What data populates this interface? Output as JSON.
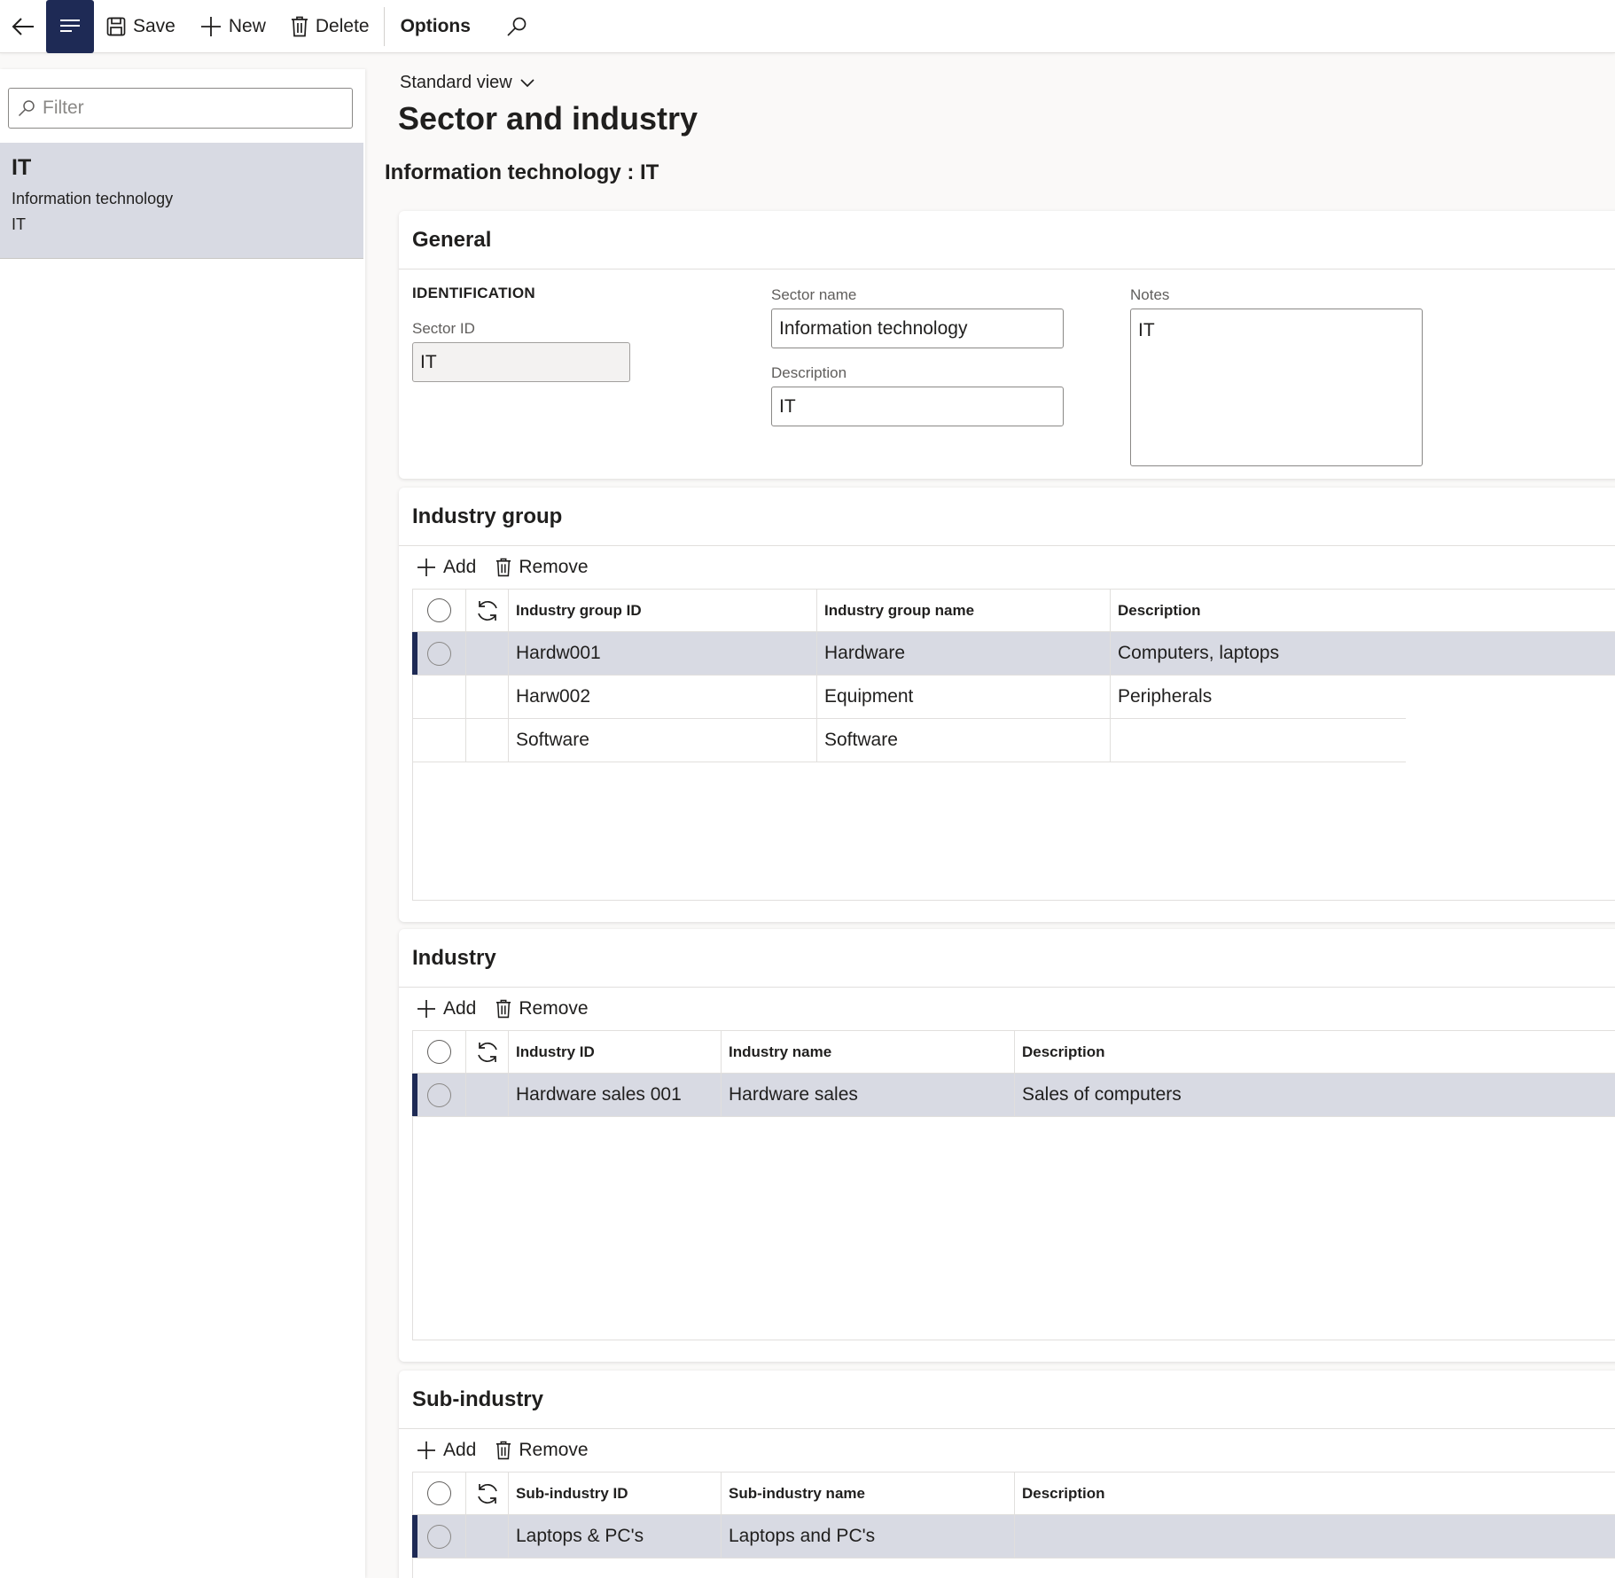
{
  "toolbar": {
    "save": "Save",
    "new": "New",
    "delete": "Delete",
    "options": "Options"
  },
  "list": {
    "filter_placeholder": "Filter",
    "items": [
      {
        "title": "IT",
        "line1": "Information technology",
        "line2": "IT"
      }
    ]
  },
  "header": {
    "view": "Standard view",
    "title": "Sector and industry",
    "record": "Information technology : IT"
  },
  "general": {
    "title": "General",
    "section": "IDENTIFICATION",
    "sector_id_label": "Sector ID",
    "sector_id": "IT",
    "sector_name_label": "Sector name",
    "sector_name": "Information technology",
    "description_label": "Description",
    "description": "IT",
    "notes_label": "Notes",
    "notes": "IT"
  },
  "industry_group": {
    "title": "Industry group",
    "add": "Add",
    "remove": "Remove",
    "columns": [
      "Industry group ID",
      "Industry group name",
      "Description"
    ],
    "rows": [
      [
        "Hardw001",
        "Hardware",
        "Computers, laptops"
      ],
      [
        "Harw002",
        "Equipment",
        "Peripherals"
      ],
      [
        "Software",
        "Software",
        ""
      ]
    ]
  },
  "industry": {
    "title": "Industry",
    "add": "Add",
    "remove": "Remove",
    "columns": [
      "Industry ID",
      "Industry name",
      "Description"
    ],
    "rows": [
      [
        "Hardware sales 001",
        "Hardware sales",
        "Sales of computers"
      ]
    ]
  },
  "sub_industry": {
    "title": "Sub-industry",
    "add": "Add",
    "remove": "Remove",
    "columns": [
      "Sub-industry ID",
      "Sub-industry name",
      "Description"
    ],
    "rows": [
      [
        "Laptops & PC's",
        "Laptops and PC's",
        ""
      ]
    ]
  },
  "colors": {
    "accent": "#1e2a55",
    "selected_row": "#d8dae3"
  }
}
